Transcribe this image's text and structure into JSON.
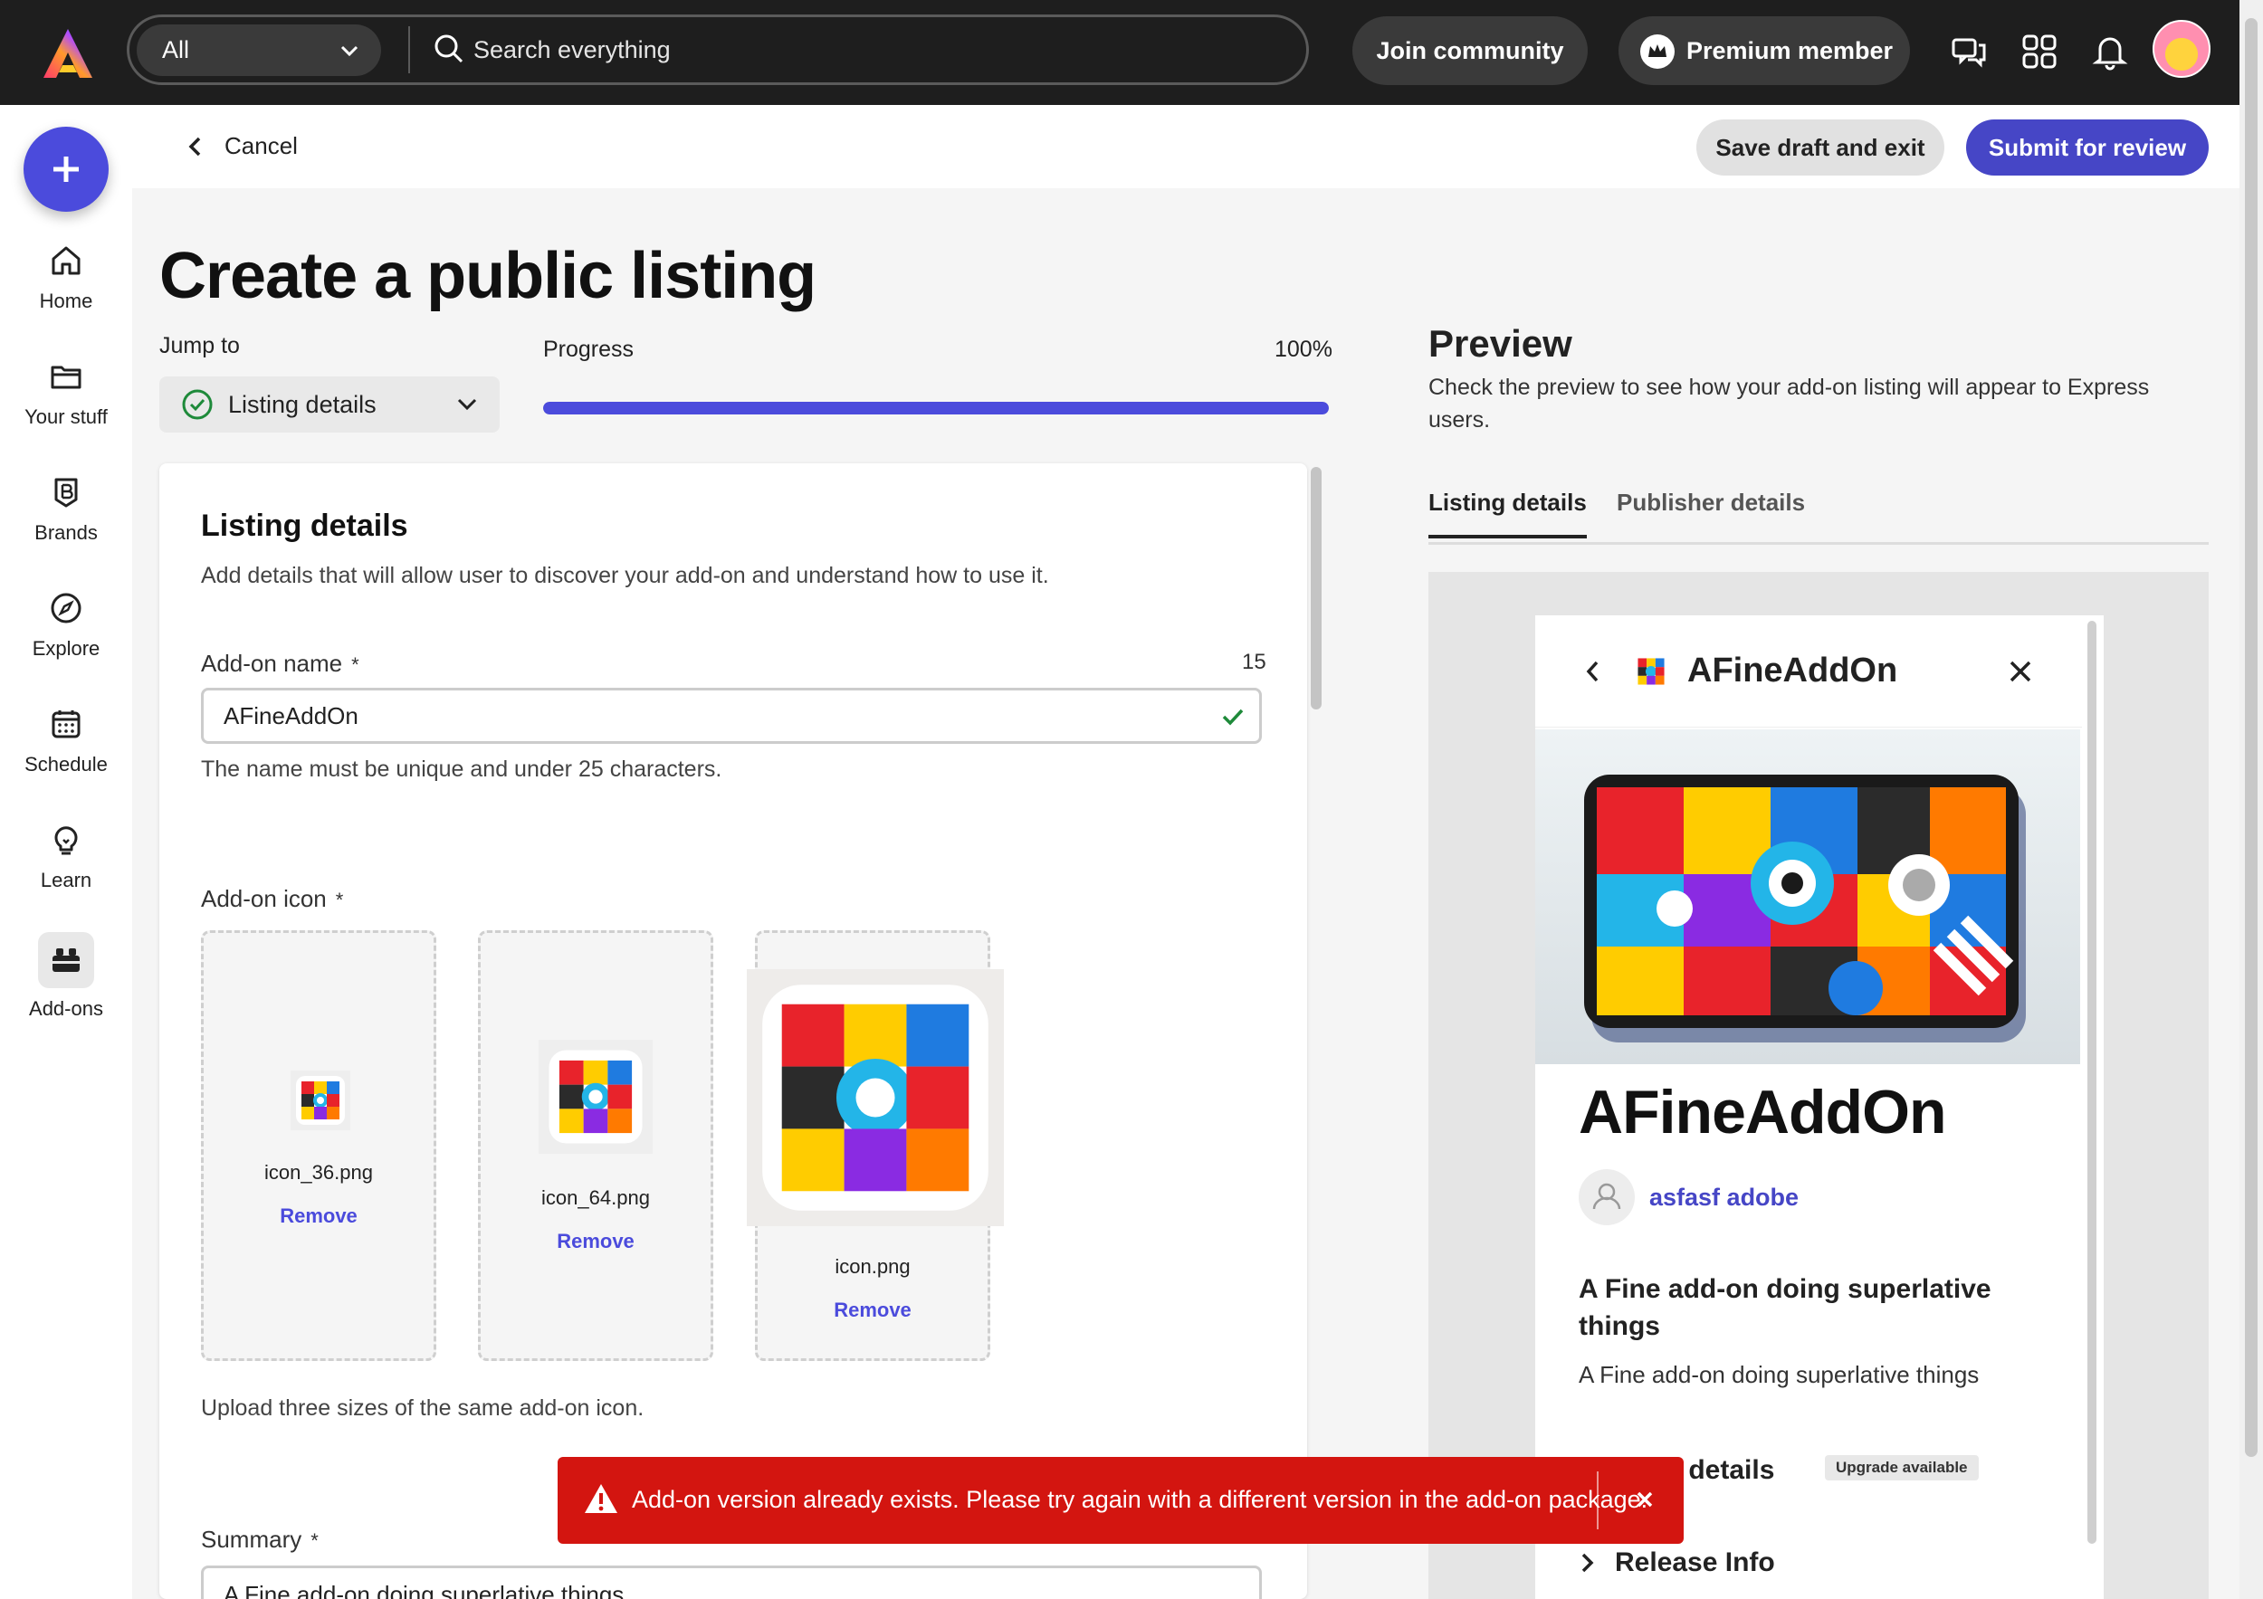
{
  "topbar": {
    "scope_value": "All",
    "search_placeholder": "Search everything",
    "join_label": "Join community",
    "premium_label": "Premium member"
  },
  "rail": {
    "items": [
      {
        "label": "Home",
        "icon": "home-icon"
      },
      {
        "label": "Your stuff",
        "icon": "folder-icon"
      },
      {
        "label": "Brands",
        "icon": "brand-icon"
      },
      {
        "label": "Explore",
        "icon": "compass-icon"
      },
      {
        "label": "Schedule",
        "icon": "calendar-icon"
      },
      {
        "label": "Learn",
        "icon": "lightbulb-icon"
      },
      {
        "label": "Add-ons",
        "icon": "addons-icon",
        "active": true
      }
    ]
  },
  "header": {
    "cancel_label": "Cancel",
    "save_label": "Save draft and exit",
    "submit_label": "Submit for review"
  },
  "main": {
    "title": "Create a public listing",
    "jump_label": "Jump to",
    "jump_value": "Listing details",
    "progress_label": "Progress",
    "progress_text": "100%",
    "progress_value": 1.0
  },
  "form": {
    "section_title": "Listing details",
    "section_desc": "Add details that will allow user to discover your add-on and understand how to use it.",
    "name_label": "Add-on name",
    "required_mark": "*",
    "name_count": "15",
    "name_value": "AFineAddOn",
    "name_help": "The name must be unique and under 25 characters.",
    "icon_label": "Add-on icon",
    "icons": [
      {
        "filename": "icon_36.png",
        "remove": "Remove"
      },
      {
        "filename": "icon_64.png",
        "remove": "Remove"
      },
      {
        "filename": "icon.png",
        "remove": "Remove"
      }
    ],
    "icon_help": "Upload three sizes of the same add-on icon.",
    "summary_label": "Summary",
    "summary_value": "A Fine add-on doing superlative things"
  },
  "preview": {
    "title": "Preview",
    "desc": "Check the preview to see how your add-on listing will appear to Express users.",
    "tabs": [
      "Listing details",
      "Publisher details"
    ],
    "addon_name": "AFineAddOn",
    "publisher": "asfasf adobe",
    "short_desc": "A Fine add-on doing superlative things",
    "long_desc": "A Fine add-on doing superlative things",
    "dev_details": "ent details",
    "upgrade_badge": "Upgrade available",
    "release_info": "Release Info"
  },
  "toast": {
    "message": "Add-on version already exists. Please try again with a different version in the add-on package.",
    "color": "#d31510"
  },
  "colors": {
    "accent": "#4b4bdc",
    "topbar": "#1e1e1e"
  }
}
